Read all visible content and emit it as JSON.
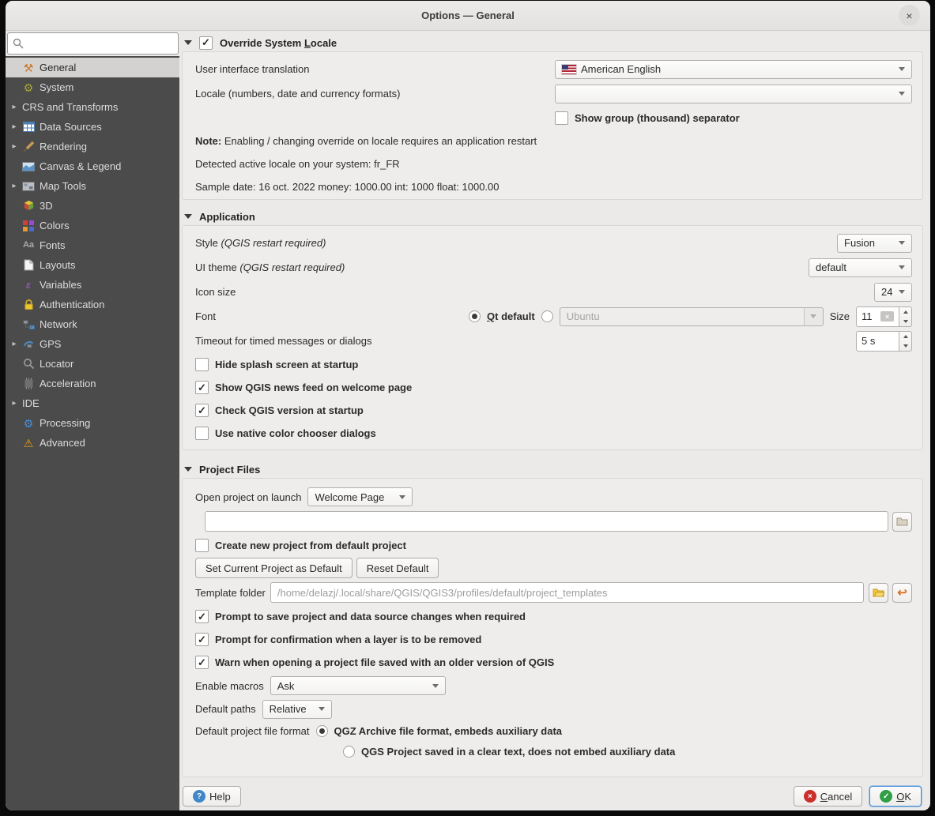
{
  "window": {
    "title": "Options — General",
    "close_glyph": "×"
  },
  "colors": {
    "sidebar_bg": "#4b4b4b",
    "selected_item_bg": "#d4d2d0",
    "dialog_bg": "#eceae8",
    "focus_blue": "#4a90d9",
    "help_icon_blue": "#3f87c9",
    "cancel_icon_red": "#c9302c",
    "ok_icon_green": "#2f9e44",
    "auth_lock_yellow": "#ecc62c",
    "warning_yellow": "#e8a21a"
  },
  "sidebar": {
    "search_value": "",
    "search_placeholder": "",
    "items": [
      {
        "label": "General",
        "icon": "general-icon",
        "selected": true
      },
      {
        "label": "System",
        "icon": "system-icon"
      },
      {
        "label": "CRS and Transforms",
        "expandable": true
      },
      {
        "label": "Data Sources",
        "icon": "data-sources-icon",
        "expandable": true
      },
      {
        "label": "Rendering",
        "icon": "rendering-icon",
        "expandable": true
      },
      {
        "label": "Canvas & Legend",
        "icon": "canvas-legend-icon"
      },
      {
        "label": "Map Tools",
        "icon": "map-tools-icon",
        "expandable": true
      },
      {
        "label": "3D",
        "icon": "cube-3d-icon"
      },
      {
        "label": "Colors",
        "icon": "colors-icon"
      },
      {
        "label": "Fonts",
        "icon": "fonts-icon"
      },
      {
        "label": "Layouts",
        "icon": "layouts-icon"
      },
      {
        "label": "Variables",
        "icon": "variables-icon"
      },
      {
        "label": "Authentication",
        "icon": "authentication-lock-icon"
      },
      {
        "label": "Network",
        "icon": "network-icon"
      },
      {
        "label": "GPS",
        "icon": "gps-icon",
        "expandable": true
      },
      {
        "label": "Locator",
        "icon": "locator-magnifier-icon"
      },
      {
        "label": "Acceleration",
        "icon": "acceleration-chip-icon"
      },
      {
        "label": "IDE",
        "expandable": true
      },
      {
        "label": "Processing",
        "icon": "processing-gear-icon"
      },
      {
        "label": "Advanced",
        "icon": "advanced-warning-icon"
      }
    ]
  },
  "locale_section": {
    "title": "Override System Locale",
    "checked": true,
    "ui_translation_label": "User interface translation",
    "ui_translation_value": "American English",
    "locale_label": "Locale (numbers, date and currency formats)",
    "locale_value": "",
    "group_separator_label": "Show group (thousand) separator",
    "group_separator_checked": false,
    "note_prefix": "Note:",
    "note_text": " Enabling / changing override on locale requires an application restart",
    "detected_locale": "Detected active locale on your system: fr_FR",
    "sample_line": "Sample date: 16 oct. 2022 money: 1000.00 int: 1000 float: 1000.00"
  },
  "application_section": {
    "title": "Application",
    "style_label": "Style",
    "style_note": "(QGIS restart required)",
    "style_value": "Fusion",
    "ui_theme_label": "UI theme",
    "ui_theme_note": "(QGIS restart required)",
    "ui_theme_value": "default",
    "icon_size_label": "Icon size",
    "icon_size_value": "24",
    "font_label": "Font",
    "qt_default_label": "Qt default",
    "qt_default_selected": true,
    "custom_font_selected": false,
    "font_family_value": "Ubuntu",
    "size_label": "Size",
    "font_size_value": "11",
    "timeout_label": "Timeout for timed messages or dialogs",
    "timeout_value": "5 s",
    "hide_splash_label": "Hide splash screen at startup",
    "hide_splash_checked": false,
    "news_feed_label": "Show QGIS news feed on welcome page",
    "news_feed_checked": true,
    "check_version_label": "Check QGIS version at startup",
    "check_version_checked": true,
    "native_color_label": "Use native color chooser dialogs",
    "native_color_checked": false
  },
  "project_section": {
    "title": "Project Files",
    "open_project_label": "Open project on launch",
    "open_project_value": "Welcome Page",
    "project_path_value": "",
    "create_new_label": "Create new project from default project",
    "create_new_checked": false,
    "set_default_button": "Set Current Project as Default",
    "reset_default_button": "Reset Default",
    "template_folder_label": "Template folder",
    "template_folder_value": "/home/delazj/.local/share/QGIS/QGIS3/profiles/default/project_templates",
    "prompt_save_label": "Prompt to save project and data source changes when required",
    "prompt_save_checked": true,
    "prompt_confirm_label": "Prompt for confirmation when a layer is to be removed",
    "prompt_confirm_checked": true,
    "warn_older_label": "Warn when opening a project file saved with an older version of QGIS",
    "warn_older_checked": true,
    "enable_macros_label": "Enable macros",
    "enable_macros_value": "Ask",
    "default_paths_label": "Default paths",
    "default_paths_value": "Relative",
    "file_format_label": "Default project file format",
    "qgz_option_label": "QGZ Archive file format, embeds auxiliary data",
    "qgz_selected": true,
    "qgs_option_label": "QGS Project saved in a clear text, does not embed auxiliary data",
    "qgs_selected": false
  },
  "footer": {
    "help": "Help",
    "cancel": "Cancel",
    "ok": "OK"
  }
}
